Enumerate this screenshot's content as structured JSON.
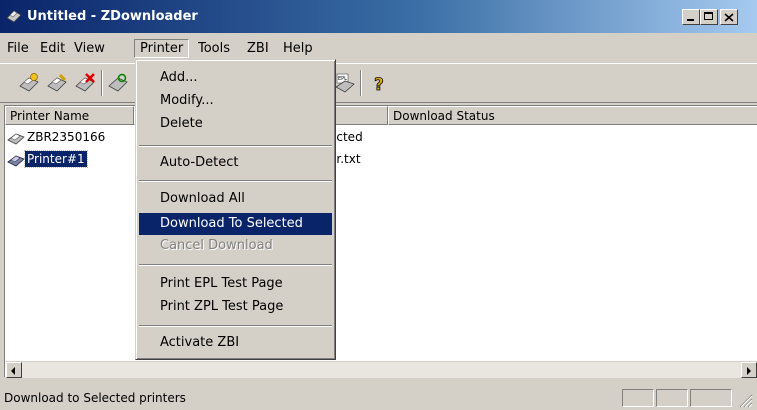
{
  "window": {
    "title": "Untitled - ZDownloader",
    "buttons": [
      "minimize",
      "maximize",
      "close"
    ]
  },
  "menubar": [
    {
      "label": "File"
    },
    {
      "label": "Edit"
    },
    {
      "label": "View"
    },
    {
      "label": "Printer",
      "active": true
    },
    {
      "label": "Tools"
    },
    {
      "label": "ZBI"
    },
    {
      "label": "Help"
    }
  ],
  "toolbar": {
    "icons": [
      "add-printer-icon",
      "modify-printer-icon",
      "delete-printer-icon",
      "autodetect-icon",
      "print-epl-icon",
      "help-icon"
    ]
  },
  "printer_menu": {
    "items": [
      {
        "label": "Add...",
        "state": "normal"
      },
      {
        "label": "Modify...",
        "state": "normal"
      },
      {
        "label": "Delete",
        "state": "normal"
      },
      {
        "label": "Auto-Detect",
        "state": "normal"
      },
      {
        "label": "Download All",
        "state": "normal"
      },
      {
        "label": "Download To Selected",
        "state": "highlighted"
      },
      {
        "label": "Cancel Download",
        "state": "disabled"
      },
      {
        "label": "Print EPL Test Page",
        "state": "normal"
      },
      {
        "label": "Print ZPL Test Page",
        "state": "normal"
      },
      {
        "label": "Activate ZBI",
        "state": "normal"
      }
    ]
  },
  "list": {
    "columns": [
      "Printer Name",
      "d File",
      "Download Status"
    ],
    "rows": [
      {
        "name": "ZBR2350166",
        "file": "ected",
        "status": "",
        "selected": false
      },
      {
        "name": "Printer#1",
        "file": "er.txt",
        "status": "",
        "selected": true
      }
    ]
  },
  "status_bar": {
    "text": "Download to Selected printers"
  },
  "colors": {
    "selection": "#0a246a",
    "face": "#d4d0c8",
    "title_start": "#0a246a",
    "title_end": "#a6caf0"
  }
}
